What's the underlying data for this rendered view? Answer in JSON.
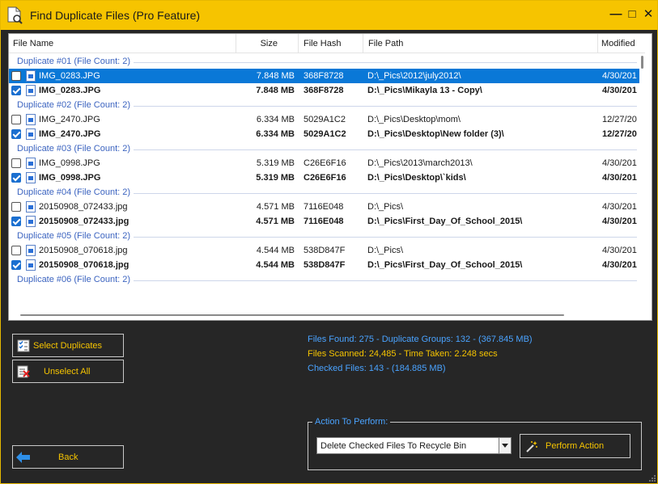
{
  "window": {
    "title": "Find Duplicate Files (Pro Feature)",
    "min_glyph": "—",
    "max_glyph": "□",
    "close_glyph": "✕",
    "accent": "#f6c400"
  },
  "table": {
    "columns": [
      "File Name",
      "Size",
      "File Hash",
      "File Path",
      "Modified"
    ],
    "groups": [
      {
        "title": "Duplicate #01 (File Count: 2)",
        "files": [
          {
            "name": "IMG_0283.JPG",
            "size": "7.848 MB",
            "hash": "368F8728",
            "path": "D:\\_Pics\\2012\\july2012\\",
            "modified": "4/30/201",
            "checked": false,
            "selected": true
          },
          {
            "name": "IMG_0283.JPG",
            "size": "7.848 MB",
            "hash": "368F8728",
            "path": "D:\\_Pics\\Mikayla 13 - Copy\\",
            "modified": "4/30/201",
            "checked": true,
            "selected": false
          }
        ]
      },
      {
        "title": "Duplicate #02 (File Count: 2)",
        "files": [
          {
            "name": "IMG_2470.JPG",
            "size": "6.334 MB",
            "hash": "5029A1C2",
            "path": "D:\\_Pics\\Desktop\\mom\\",
            "modified": "12/27/20",
            "checked": false,
            "selected": false
          },
          {
            "name": "IMG_2470.JPG",
            "size": "6.334 MB",
            "hash": "5029A1C2",
            "path": "D:\\_Pics\\Desktop\\New folder (3)\\",
            "modified": "12/27/20",
            "checked": true,
            "selected": false
          }
        ]
      },
      {
        "title": "Duplicate #03 (File Count: 2)",
        "files": [
          {
            "name": "IMG_0998.JPG",
            "size": "5.319 MB",
            "hash": "C26E6F16",
            "path": "D:\\_Pics\\2013\\march2013\\",
            "modified": "4/30/201",
            "checked": false,
            "selected": false
          },
          {
            "name": "IMG_0998.JPG",
            "size": "5.319 MB",
            "hash": "C26E6F16",
            "path": "D:\\_Pics\\Desktop\\`kids\\",
            "modified": "4/30/201",
            "checked": true,
            "selected": false
          }
        ]
      },
      {
        "title": "Duplicate #04 (File Count: 2)",
        "files": [
          {
            "name": "20150908_072433.jpg",
            "size": "4.571 MB",
            "hash": "7116E048",
            "path": "D:\\_Pics\\",
            "modified": "4/30/201",
            "checked": false,
            "selected": false
          },
          {
            "name": "20150908_072433.jpg",
            "size": "4.571 MB",
            "hash": "7116E048",
            "path": "D:\\_Pics\\First_Day_Of_School_2015\\",
            "modified": "4/30/201",
            "checked": true,
            "selected": false
          }
        ]
      },
      {
        "title": "Duplicate #05 (File Count: 2)",
        "files": [
          {
            "name": "20150908_070618.jpg",
            "size": "4.544 MB",
            "hash": "538D847F",
            "path": "D:\\_Pics\\",
            "modified": "4/30/201",
            "checked": false,
            "selected": false
          },
          {
            "name": "20150908_070618.jpg",
            "size": "4.544 MB",
            "hash": "538D847F",
            "path": "D:\\_Pics\\First_Day_Of_School_2015\\",
            "modified": "4/30/201",
            "checked": true,
            "selected": false
          }
        ]
      },
      {
        "title": "Duplicate #06 (File Count: 2)",
        "files": []
      }
    ]
  },
  "buttons": {
    "select_duplicates": "Select Duplicates",
    "unselect_all": "Unselect All",
    "back": "Back",
    "perform_action": "Perform Action"
  },
  "stats": {
    "found": "Files Found: 275 - Duplicate Groups: 132 - (367.845 MB)",
    "scanned": "Files Scanned: 24,485 - Time Taken: 2.248 secs",
    "checked": "Checked Files: 143 - (184.885 MB)"
  },
  "action": {
    "legend": "Action To Perform:",
    "selected_option": "Delete Checked Files To Recycle Bin"
  },
  "colors": {
    "titlebar": "#f6c400",
    "stat_blue": "#4aa3ff",
    "stat_yellow": "#f6c400",
    "group_title": "#3c64c0",
    "selection": "#0a78d7"
  }
}
